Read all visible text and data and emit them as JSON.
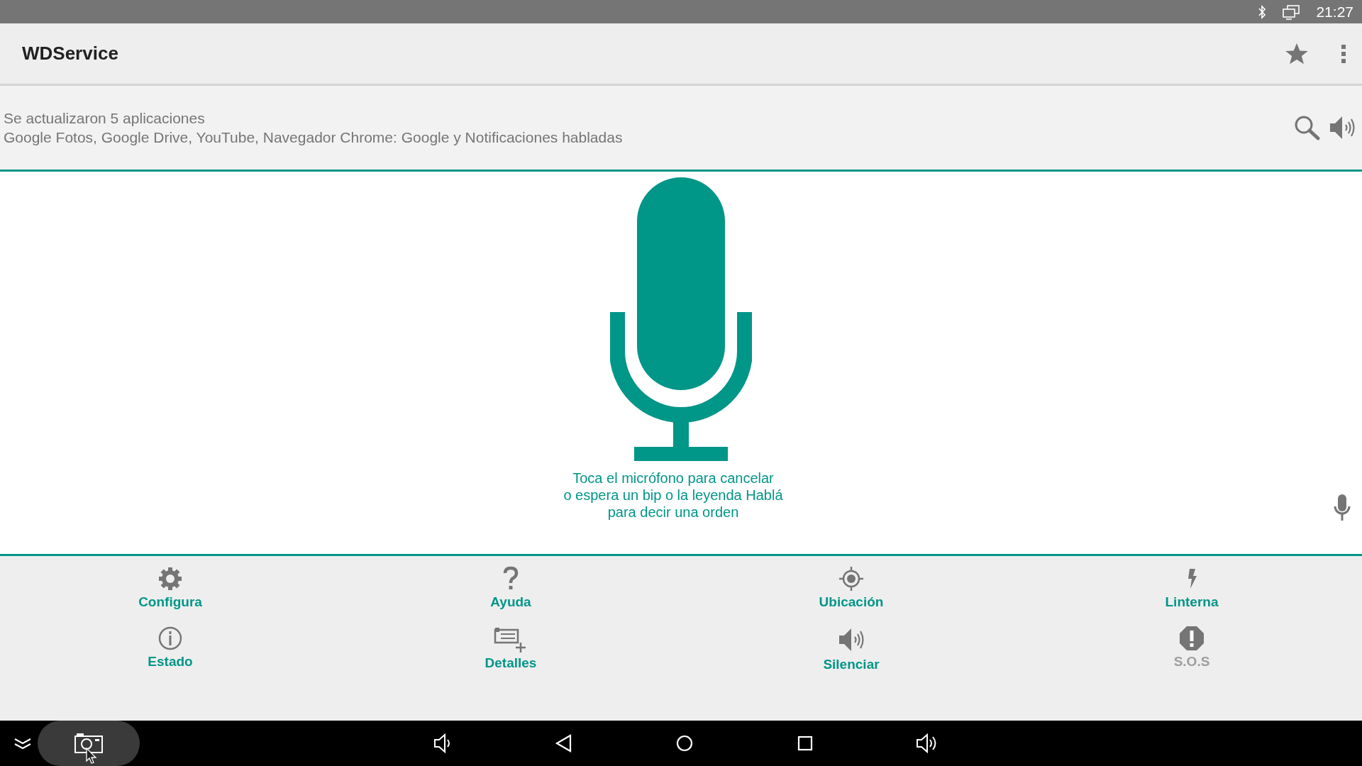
{
  "status_bar": {
    "time": "21:27"
  },
  "app_bar": {
    "title": "WDService"
  },
  "notification": {
    "title": "Se actualizaron 5 aplicaciones",
    "text": "Google Fotos, Google Drive, YouTube, Navegador Chrome: Google y Notificaciones habladas"
  },
  "voice": {
    "lines": [
      "Toca el micrófono para cancelar",
      "o espera un bip o la leyenda Hablá",
      "para decir una orden"
    ]
  },
  "actions": [
    {
      "label": "Configura",
      "disabled": false
    },
    {
      "label": "Ayuda",
      "disabled": false
    },
    {
      "label": "Ubicación",
      "disabled": false
    },
    {
      "label": "Linterna",
      "disabled": false
    },
    {
      "label": "Estado",
      "disabled": false
    },
    {
      "label": "Detalles",
      "disabled": false
    },
    {
      "label": "Silenciar",
      "disabled": false
    },
    {
      "label": "S.O.S",
      "disabled": true
    }
  ]
}
